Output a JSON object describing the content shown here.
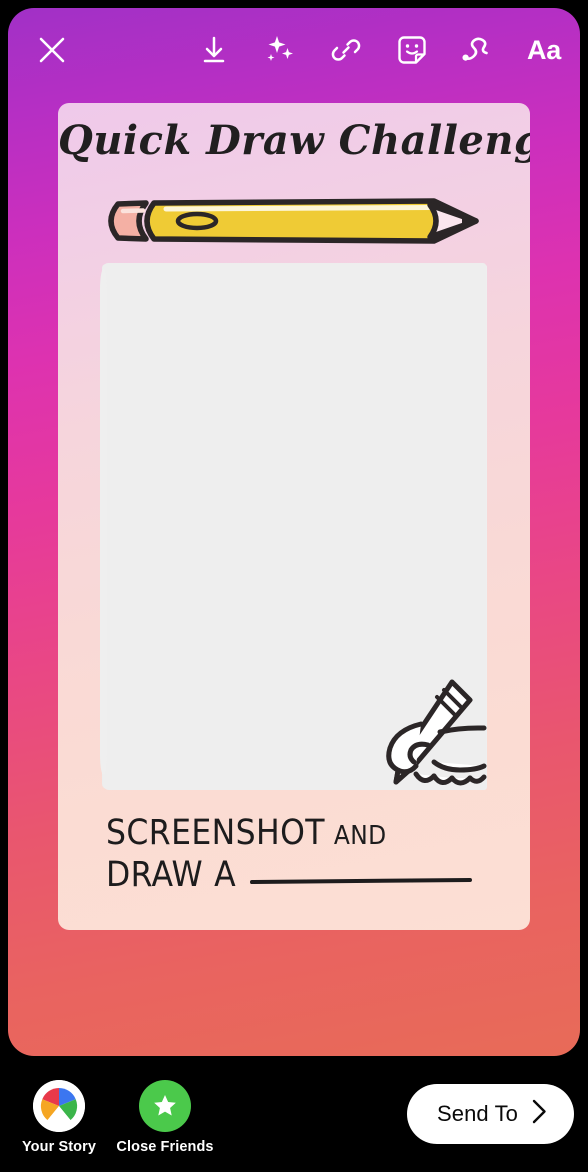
{
  "app": {
    "name": "instagram-story-editor",
    "background_gradient": {
      "top": "#a130c6",
      "middle": "#e6399c",
      "bottom": "#e86b58"
    }
  },
  "toolbar": {
    "close": {
      "label": "Close",
      "icon": "close-icon"
    },
    "tools": [
      {
        "name": "save-icon",
        "label": "Save"
      },
      {
        "name": "effects-sparkle-icon",
        "label": "Effects"
      },
      {
        "name": "link-icon",
        "label": "Link"
      },
      {
        "name": "sticker-smiley-icon",
        "label": "Sticker"
      },
      {
        "name": "draw-squiggle-icon",
        "label": "Draw"
      },
      {
        "name": "text-aa-icon",
        "label": "Aa"
      }
    ]
  },
  "sticker_card": {
    "title": "Quick Draw Challenge",
    "decoration_icon": "pencil-icon",
    "drawing_area_label": "blank drawing area",
    "hand_icon": "hand-drawing-with-pencil-icon",
    "prompt": {
      "word_1": "SCREENSHOT",
      "word_2": "AND",
      "word_3": "DRAW",
      "word_4": "A",
      "blank": ""
    },
    "colors": {
      "card_top": "#efc9ea",
      "card_bottom": "#fcdfd4",
      "drawing_area": "#eeeeee",
      "pencil_body": "#efcb35",
      "pencil_eraser": "#f4b0a4",
      "ink": "#1d1c1d"
    }
  },
  "bottom_bar": {
    "audiences": [
      {
        "name": "your-story",
        "label": "Your Story",
        "icon": "pinwheel-avatar-icon"
      },
      {
        "name": "close-friends",
        "label": "Close Friends",
        "icon": "green-star-icon",
        "color": "#4bc94b"
      }
    ],
    "send_to": {
      "label": "Send To",
      "icon": "chevron-right-icon"
    }
  }
}
